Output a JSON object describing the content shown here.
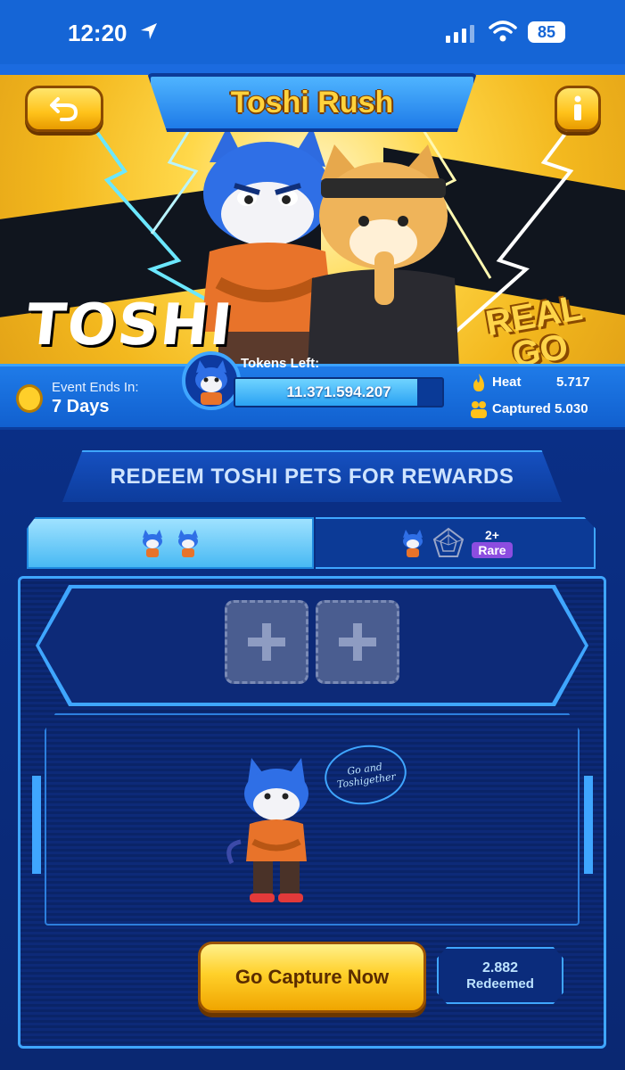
{
  "status_bar": {
    "time": "12:20",
    "battery": "85"
  },
  "header": {
    "title": "Toshi Rush",
    "back_icon": "undo-icon",
    "info_icon": "info-icon"
  },
  "banner": {
    "left_text": "TOSHI",
    "right_text_line1": "REAL",
    "right_text_line2": "GO"
  },
  "event": {
    "label": "Event Ends In:",
    "value": "7 Days"
  },
  "tokens": {
    "label": "Tokens Left:",
    "value": "11.371.594.207",
    "fill_percent": 88
  },
  "stats": {
    "heat_label": "Heat",
    "heat_value": "5.717",
    "captured_label": "Captured 5.030"
  },
  "redeem": {
    "title": "REDEEM TOSHI PETS FOR REWARDS"
  },
  "tabs": {
    "right_count": "2+",
    "right_badge": "Rare"
  },
  "bubble": {
    "line1": "Go and",
    "line2": "Toshigether"
  },
  "cta": {
    "label": "Go Capture Now"
  },
  "redeemed": {
    "count": "2.882",
    "label": "Redeemed"
  },
  "colors": {
    "accent": "#3fa6ff",
    "gold": "#ffd02a",
    "rare": "#8c4de0"
  }
}
